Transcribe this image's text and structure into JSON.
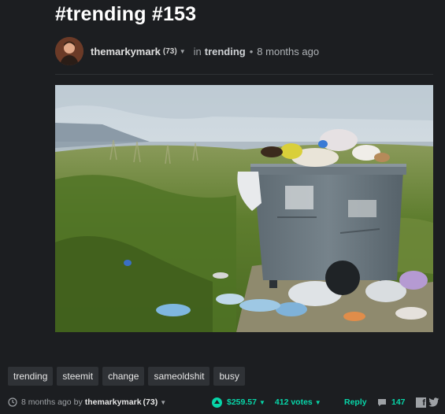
{
  "post": {
    "title": "#trending #153",
    "author": "themarkymark",
    "reputation": "(73)",
    "in_label": "in",
    "category": "trending",
    "separator": "•",
    "time_ago": "8 months ago"
  },
  "tags": [
    "trending",
    "steemit",
    "change",
    "sameoldshit",
    "busy"
  ],
  "footer": {
    "time_ago": "8 months ago",
    "by_label": "by",
    "author": "themarkymark",
    "reputation": "(73)",
    "payout": "$259.57",
    "votes": "412 votes",
    "reply": "Reply",
    "comments": "147"
  },
  "icons": {
    "clock": "clock-icon",
    "upvote": "upvote-icon",
    "comments": "comment-icon",
    "facebook": "facebook-icon",
    "twitter": "twitter-icon"
  },
  "colors": {
    "background": "#1c1e21",
    "accent": "#07d6a9",
    "tag_bg": "#2f3236"
  }
}
